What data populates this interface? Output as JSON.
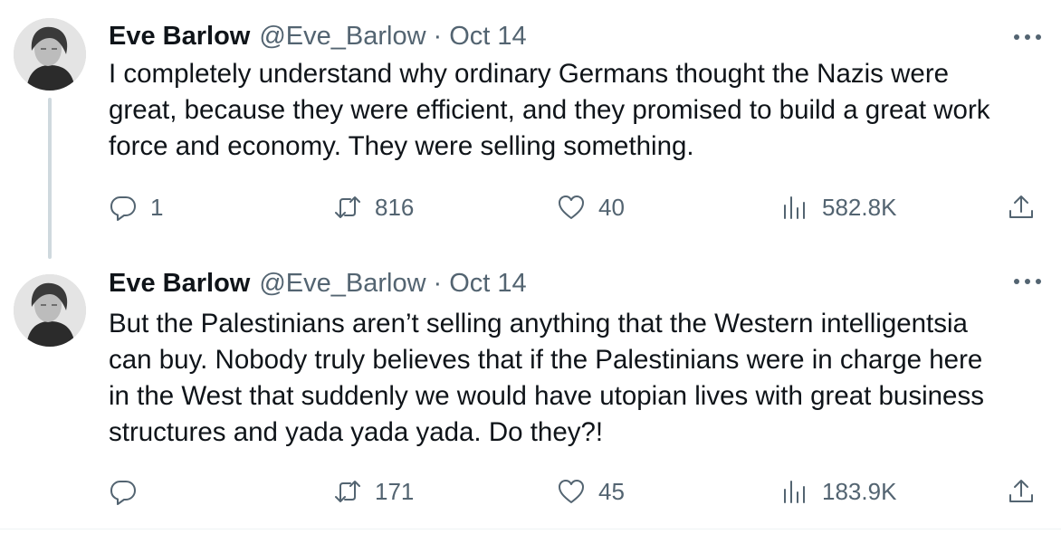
{
  "tweets": [
    {
      "author": {
        "name": "Eve Barlow",
        "handle": "@Eve_Barlow"
      },
      "separator": "·",
      "date": "Oct 14",
      "text": "I completely understand why ordinary Germans thought the Nazis were\ngreat, because they were efficient, and they promised to build a great work\nforce and economy. They were selling something.",
      "stats": {
        "replies": "1",
        "retweets": "816",
        "likes": "40",
        "views": "582.8K"
      }
    },
    {
      "author": {
        "name": "Eve Barlow",
        "handle": "@Eve_Barlow"
      },
      "separator": "·",
      "date": "Oct 14",
      "text": "But the Palestinians aren’t selling anything that the Western intelligentsia\ncan buy. Nobody truly believes that if the Palestinians were in charge here\nin the West that suddenly we would have utopian lives with great business\nstructures and yada yada yada. Do they?!",
      "stats": {
        "replies": "",
        "retweets": "171",
        "likes": "45",
        "views": "183.9K"
      }
    }
  ],
  "icons": {
    "reply": "reply-icon",
    "retweet": "retweet-icon",
    "like": "heart-icon",
    "views": "views-icon",
    "share": "share-icon",
    "more": "more-options-icon"
  },
  "colors": {
    "text": "#0f1419",
    "secondary": "#536471",
    "thread_line": "#cfd9de"
  }
}
